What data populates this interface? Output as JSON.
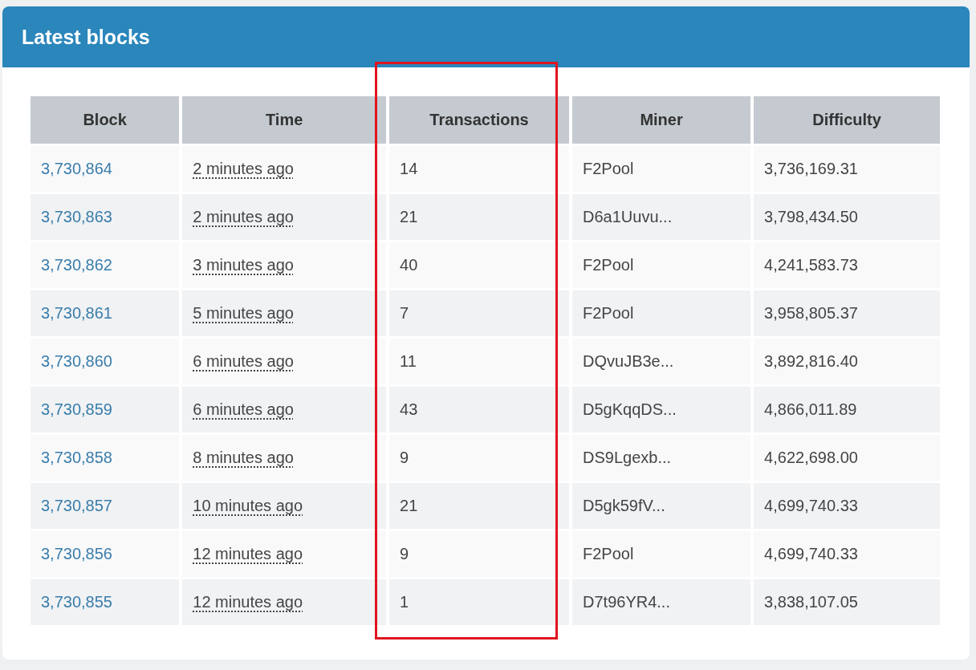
{
  "panel": {
    "title": "Latest blocks"
  },
  "table": {
    "columns": [
      {
        "label": "Block",
        "highlighted": false
      },
      {
        "label": "Time",
        "highlighted": false
      },
      {
        "label": "Transactions",
        "highlighted": true
      },
      {
        "label": "Miner",
        "highlighted": false
      },
      {
        "label": "Difficulty",
        "highlighted": false
      }
    ],
    "rows": [
      {
        "block": "3,730,864",
        "time": "2 minutes ago",
        "transactions": "14",
        "miner": "F2Pool",
        "difficulty": "3,736,169.31"
      },
      {
        "block": "3,730,863",
        "time": "2 minutes ago",
        "transactions": "21",
        "miner": "D6a1Uuvu...",
        "difficulty": "3,798,434.50"
      },
      {
        "block": "3,730,862",
        "time": "3 minutes ago",
        "transactions": "40",
        "miner": "F2Pool",
        "difficulty": "4,241,583.73"
      },
      {
        "block": "3,730,861",
        "time": "5 minutes ago",
        "transactions": "7",
        "miner": "F2Pool",
        "difficulty": "3,958,805.37"
      },
      {
        "block": "3,730,860",
        "time": "6 minutes ago",
        "transactions": "11",
        "miner": "DQvuJB3e...",
        "difficulty": "3,892,816.40"
      },
      {
        "block": "3,730,859",
        "time": "6 minutes ago",
        "transactions": "43",
        "miner": "D5gKqqDS...",
        "difficulty": "4,866,011.89"
      },
      {
        "block": "3,730,858",
        "time": "8 minutes ago",
        "transactions": "9",
        "miner": "DS9Lgexb...",
        "difficulty": "4,622,698.00"
      },
      {
        "block": "3,730,857",
        "time": "10 minutes ago",
        "transactions": "21",
        "miner": "D5gk59fV...",
        "difficulty": "4,699,740.33"
      },
      {
        "block": "3,730,856",
        "time": "12 minutes ago",
        "transactions": "9",
        "miner": "F2Pool",
        "difficulty": "4,699,740.33"
      },
      {
        "block": "3,730,855",
        "time": "12 minutes ago",
        "transactions": "1",
        "miner": "D7t96YR4...",
        "difficulty": "3,838,107.05"
      }
    ]
  }
}
